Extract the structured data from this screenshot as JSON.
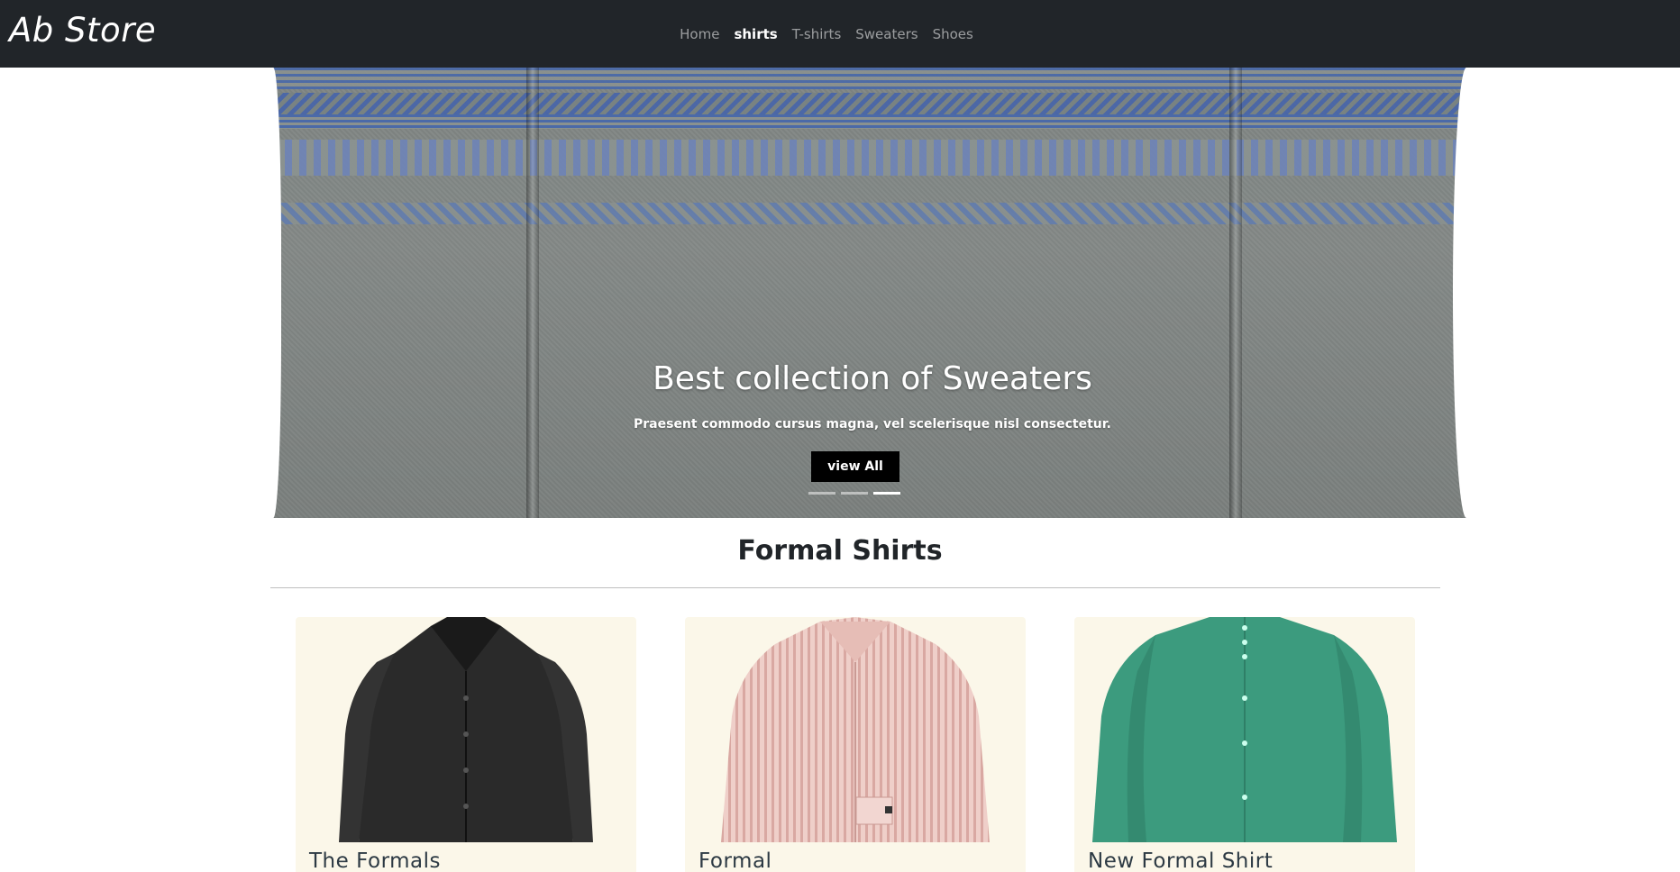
{
  "brand": "Ab Store",
  "nav": {
    "items": [
      {
        "label": "Home",
        "active": false
      },
      {
        "label": "shirts",
        "active": true
      },
      {
        "label": "T-shirts",
        "active": false
      },
      {
        "label": "Sweaters",
        "active": false
      },
      {
        "label": "Shoes",
        "active": false
      }
    ]
  },
  "hero": {
    "title": "Best collection of Sweaters",
    "subtitle": "Praesent commodo cursus magna, vel scelerisque nisl consectetur.",
    "button_label": "view All",
    "slide_count": 3,
    "active_slide": 3
  },
  "section": {
    "title": "Formal Shirts"
  },
  "products": [
    {
      "title": "The Formals",
      "color": "#2a2a2a"
    },
    {
      "title": "Formal",
      "color": "#e9c2bd"
    },
    {
      "title": "New Formal Shirt",
      "color": "#3c9b7e"
    }
  ],
  "colors": {
    "navbar": "#212529",
    "card_bg": "#fbf7e9",
    "button_bg": "#000000"
  }
}
